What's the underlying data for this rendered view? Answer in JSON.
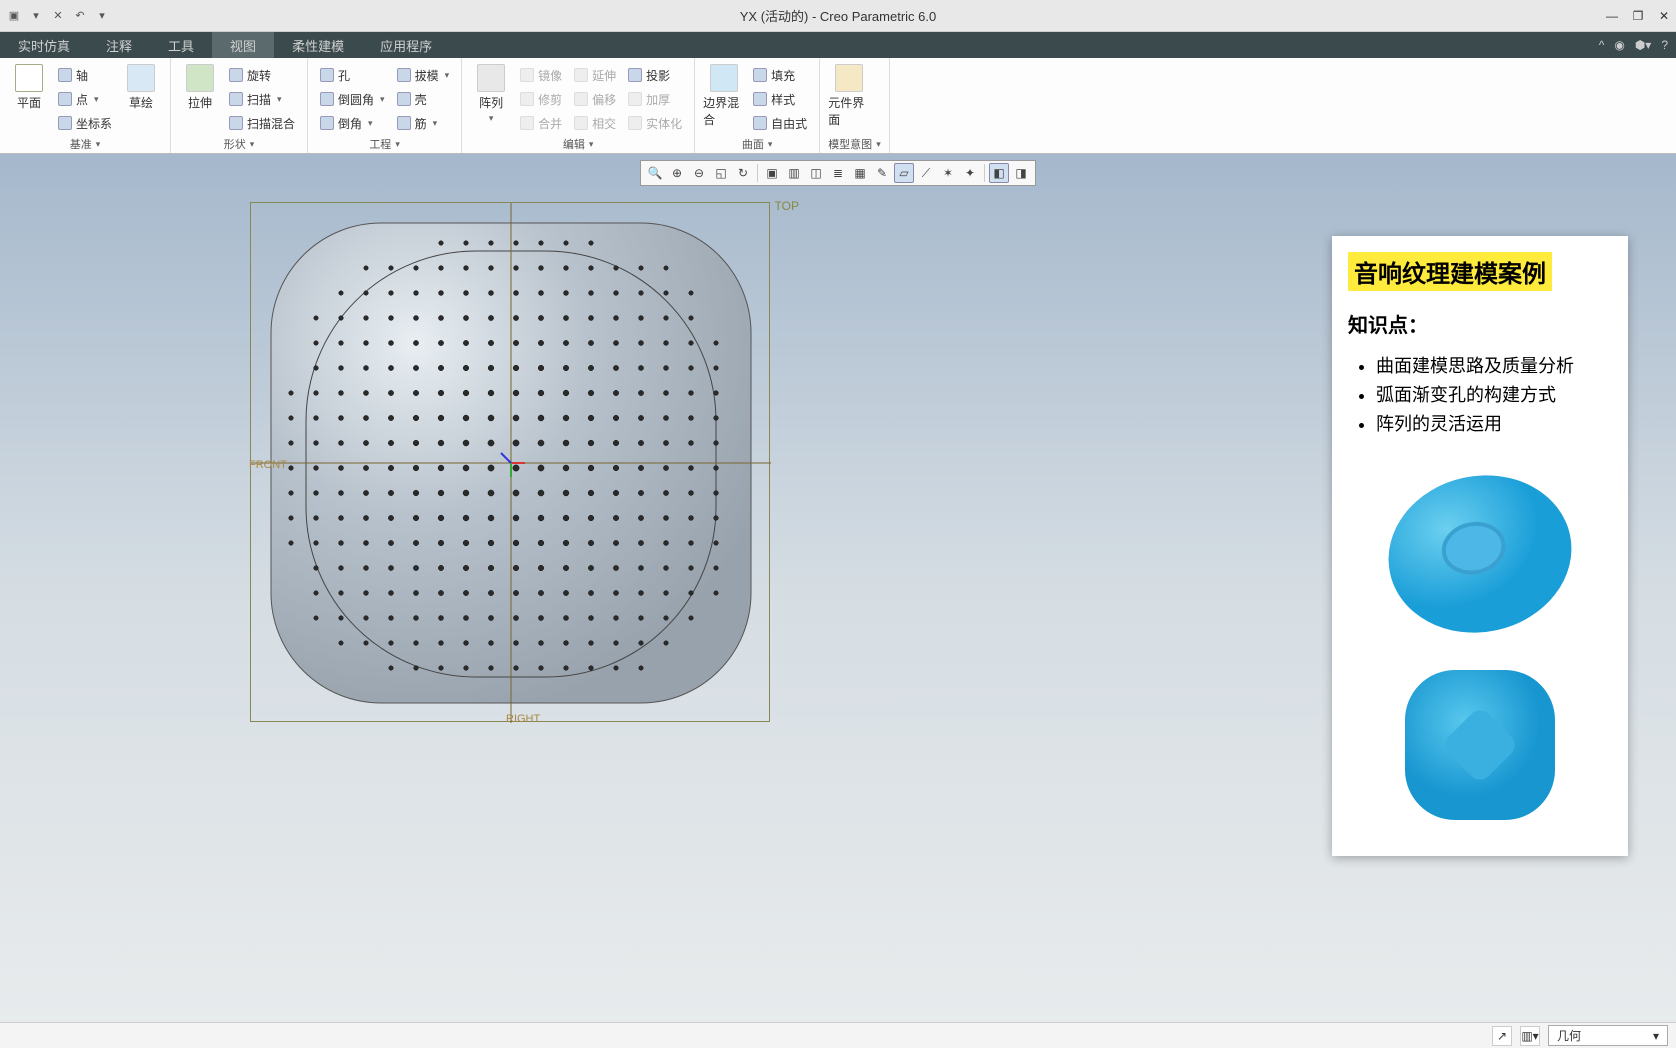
{
  "titlebar": {
    "title": "YX (活动的) - Creo Parametric 6.0"
  },
  "menubar": {
    "tabs": [
      "实时仿真",
      "注释",
      "工具",
      "视图",
      "柔性建模",
      "应用程序"
    ],
    "active_index": 3
  },
  "ribbon": {
    "groups": [
      {
        "label": "基准",
        "big": [
          {
            "label": "平面"
          }
        ],
        "cols": [
          [
            {
              "label": "轴",
              "icon": "axis"
            },
            {
              "label": "点",
              "icon": "point",
              "caret": true
            },
            {
              "label": "坐标系",
              "icon": "csys"
            }
          ]
        ],
        "extra_big": [
          {
            "label": "草绘"
          }
        ]
      },
      {
        "label": "形状",
        "big": [
          {
            "label": "拉伸"
          }
        ],
        "cols": [
          [
            {
              "label": "旋转",
              "icon": "revolve"
            },
            {
              "label": "扫描",
              "icon": "sweep",
              "caret": true
            },
            {
              "label": "扫描混合",
              "icon": "swept-blend"
            }
          ]
        ]
      },
      {
        "label": "工程",
        "cols": [
          [
            {
              "label": "孔",
              "icon": "hole"
            },
            {
              "label": "倒圆角",
              "icon": "round",
              "caret": true
            },
            {
              "label": "倒角",
              "icon": "chamfer",
              "caret": true
            }
          ],
          [
            {
              "label": "拔模",
              "icon": "draft",
              "caret": true
            },
            {
              "label": "壳",
              "icon": "shell"
            },
            {
              "label": "筋",
              "icon": "rib",
              "caret": true
            }
          ]
        ]
      },
      {
        "label": "编辑",
        "big": [
          {
            "label": "阵列"
          }
        ],
        "cols": [
          [
            {
              "label": "镜像",
              "disabled": true
            },
            {
              "label": "修剪",
              "disabled": true
            },
            {
              "label": "合并",
              "disabled": true
            }
          ],
          [
            {
              "label": "延伸",
              "disabled": true
            },
            {
              "label": "偏移",
              "disabled": true
            },
            {
              "label": "相交",
              "disabled": true
            }
          ],
          [
            {
              "label": "投影"
            },
            {
              "label": "加厚",
              "disabled": true
            },
            {
              "label": "实体化",
              "disabled": true
            }
          ]
        ]
      },
      {
        "label": "曲面",
        "big": [
          {
            "label": "边界混合"
          }
        ],
        "cols": [
          [
            {
              "label": "填充"
            },
            {
              "label": "样式"
            },
            {
              "label": "自由式"
            }
          ]
        ]
      },
      {
        "label": "模型意图",
        "big": [
          {
            "label": "元件界面"
          }
        ]
      }
    ]
  },
  "view_toolbar": {
    "icons": [
      "refit",
      "zoom-in",
      "zoom-out",
      "zoom-sel",
      "spin",
      "repaint",
      "named-views",
      "view-mgr",
      "layers",
      "sel-filter",
      "annot",
      "datum-plane",
      "datum-axis",
      "datum-point",
      "datum-csys",
      "grid",
      "sep",
      "display-style",
      "perspective"
    ]
  },
  "model": {
    "labels": {
      "top": "TOP",
      "front": "FRONT",
      "right": "RIGHT"
    }
  },
  "overlay": {
    "title": "音响纹理建模案例",
    "subtitle": "知识点：",
    "bullets": [
      "曲面建模思路及质量分析",
      "弧面渐变孔的构建方式",
      "阵列的灵活运用"
    ]
  },
  "statusbar": {
    "filter": "几何"
  }
}
